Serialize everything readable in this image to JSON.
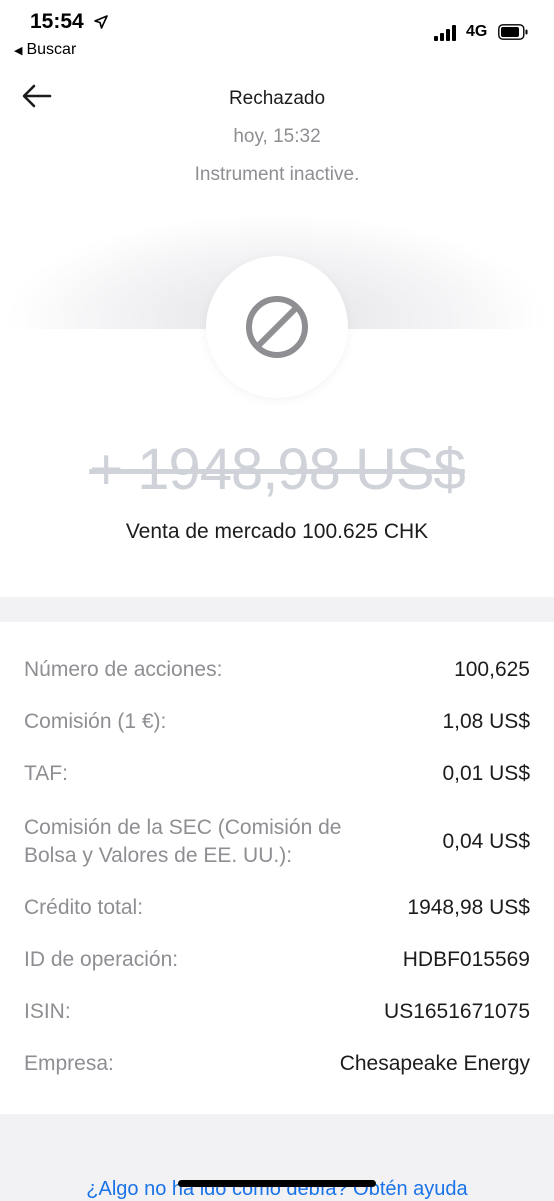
{
  "status_bar": {
    "time": "15:54",
    "back_app": "Buscar",
    "network": "4G"
  },
  "header": {
    "title": "Rechazado",
    "date": "hoy, 15:32",
    "reason": "Instrument inactive."
  },
  "order": {
    "amount": "+ 1948,98 US$",
    "description": "Venta de mercado 100.625 CHK",
    "status_icon": "prohibited-icon"
  },
  "details": [
    {
      "label": "Número de acciones:",
      "value": "100,625"
    },
    {
      "label": "Comisión (1 €):",
      "value": "1,08 US$"
    },
    {
      "label": "TAF:",
      "value": "0,01 US$"
    },
    {
      "label": "Comisión de la SEC (Comisión de Bolsa y Valores de EE. UU.):",
      "value": "0,04 US$"
    },
    {
      "label": "Crédito total:",
      "value": "1948,98 US$"
    },
    {
      "label": "ID de operación:",
      "value": "HDBF015569"
    },
    {
      "label": "ISIN:",
      "value": "US1651671075"
    },
    {
      "label": "Empresa:",
      "value": "Chesapeake Energy"
    }
  ],
  "help_link": "¿Algo no ha ido como debía? Obtén ayuda",
  "colors": {
    "accent_link": "#1a73e8",
    "muted_text": "#8e8e93",
    "strikethrough_amount": "#cfd2d8"
  }
}
